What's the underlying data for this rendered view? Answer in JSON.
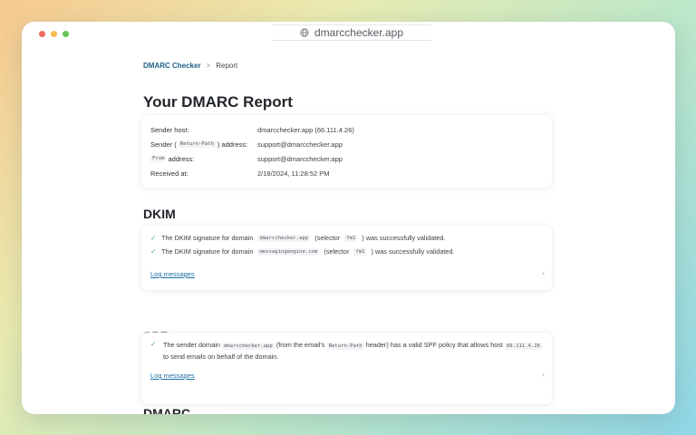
{
  "browser": {
    "url": "dmarcchecker.app"
  },
  "breadcrumb": {
    "root": "DMARC Checker",
    "separator": ">",
    "current": "Report"
  },
  "page_title": "Your DMARC Report",
  "summary": {
    "sender_host_label": "Sender host:",
    "sender_host_value": "dmarcchecker.app (66.111.4.26)",
    "sender_prefix": "Sender (",
    "return_path_code": "Return-Path",
    "sender_suffix": ") address:",
    "sender_value": "support@dmarcchecker.app",
    "from_code": "From",
    "from_suffix": "address:",
    "from_value": "support@dmarcchecker.app",
    "received_label": "Received at:",
    "received_value": "2/18/2024, 11:28:52 PM"
  },
  "dkim": {
    "heading": "DKIM",
    "lines": [
      {
        "prefix": "The DKIM signature for domain",
        "domain": "dmarcchecker.app",
        "middle": "(selector",
        "selector": "fm1",
        "suffix": ") was successfully validated."
      },
      {
        "prefix": "The DKIM signature for domain",
        "domain": "messagingengine.com",
        "middle": "(selector",
        "selector": "fm1",
        "suffix": ") was successfully validated."
      }
    ],
    "log_messages": "Log messages"
  },
  "spf": {
    "heading": "SPF",
    "text_1": "The sender domain",
    "domain": "dmarcchecker.app",
    "text_2": "(from the email's",
    "return_path_code": "Return-Path",
    "text_3": "header) has a valid SPF policy that allows host",
    "host_ip": "66.111.4.26",
    "text_4": "to send emails on behalf of the domain.",
    "log_messages": "Log messages"
  },
  "dmarc": {
    "heading": "DMARC"
  },
  "colors": {
    "link": "#1d6fa8",
    "brand": "#1d5f88",
    "success": "#3ca36b"
  }
}
